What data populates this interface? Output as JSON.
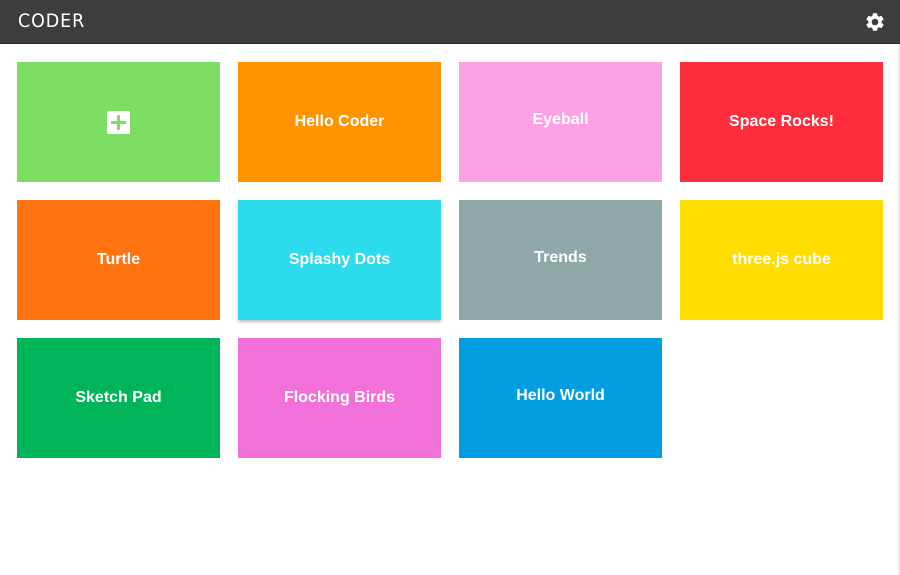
{
  "header": {
    "app_title": "CODER",
    "settings_icon": "gear-icon"
  },
  "tiles": [
    {
      "id": "new-app",
      "label": "",
      "icon": "plus-icon",
      "color": "#7ddc62"
    },
    {
      "id": "hello-coder",
      "label": "Hello Coder",
      "color": "#ff9400"
    },
    {
      "id": "eyeball",
      "label": "Eyeball",
      "color": "#fea1e4"
    },
    {
      "id": "space-rocks",
      "label": "Space Rocks!",
      "color": "#ff2d3b"
    },
    {
      "id": "turtle",
      "label": "Turtle",
      "color": "#ff7310"
    },
    {
      "id": "splashy-dots",
      "label": "Splashy Dots",
      "color": "#2ddcec"
    },
    {
      "id": "trends",
      "label": "Trends",
      "color": "#8fa8a8"
    },
    {
      "id": "threejs-cube",
      "label": "three.js cube",
      "color": "#ffdd00"
    },
    {
      "id": "sketch-pad",
      "label": "Sketch Pad",
      "color": "#00b45a"
    },
    {
      "id": "flocking-birds",
      "label": "Flocking Birds",
      "color": "#f270d9"
    },
    {
      "id": "hello-world",
      "label": "Hello World",
      "color": "#009ee0"
    }
  ]
}
